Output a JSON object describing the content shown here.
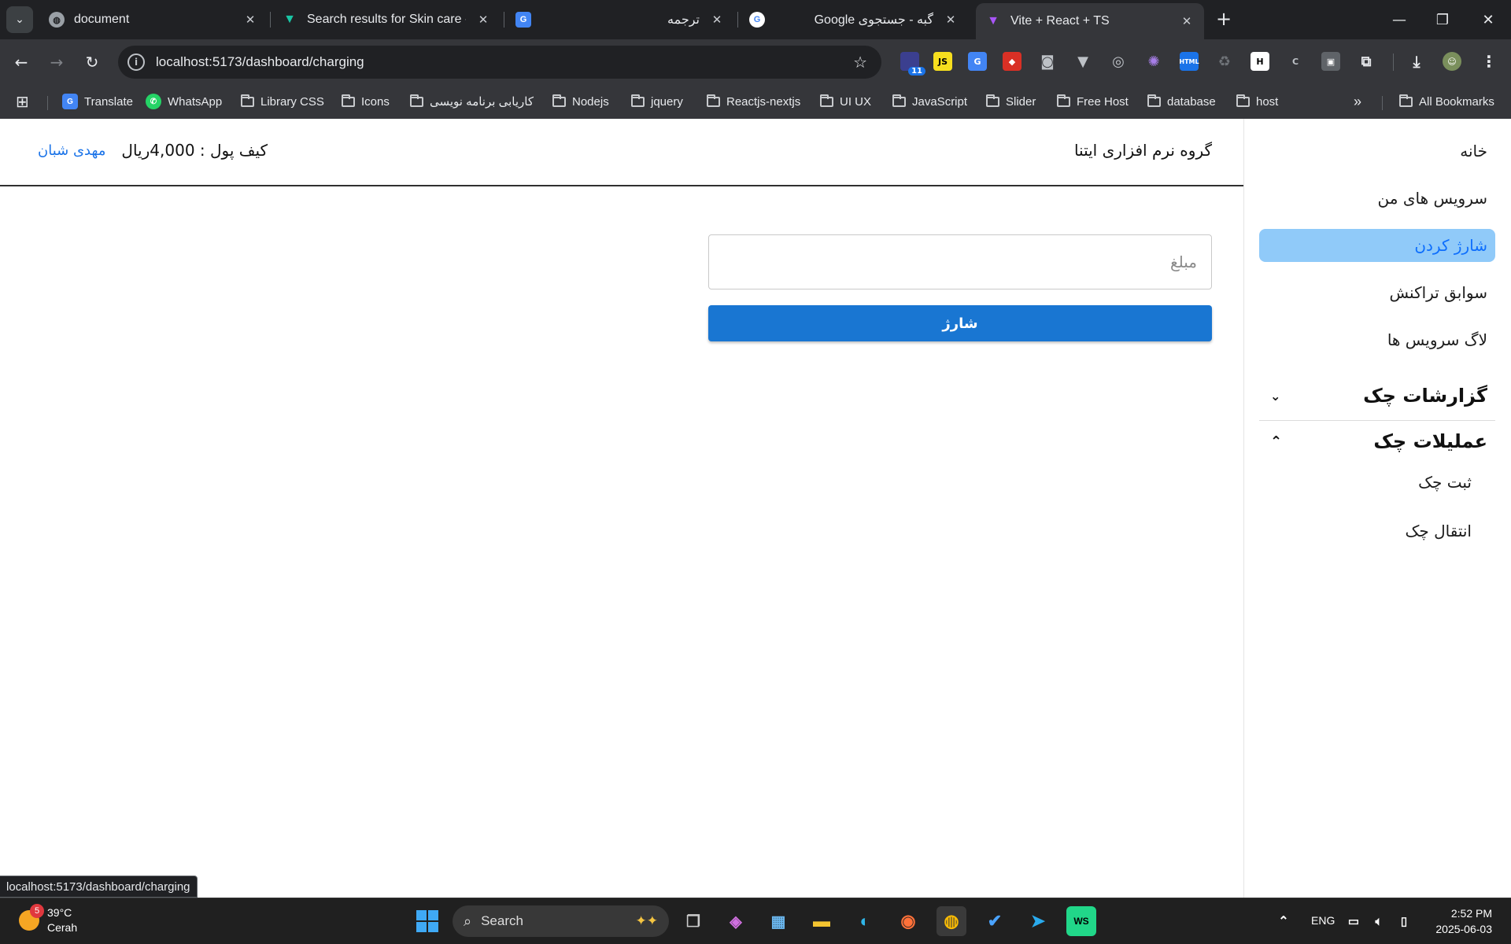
{
  "browser": {
    "tabs": [
      {
        "title": "document",
        "active": false
      },
      {
        "title": "Search results for Skin care - Fla",
        "active": false
      },
      {
        "title": "ترجمه",
        "active": false
      },
      {
        "title": "گبه - جستجوی Google",
        "active": false
      },
      {
        "title": "Vite + React + TS",
        "active": true
      }
    ],
    "url": "localhost:5173/dashboard/charging",
    "extension_badge": "11",
    "bookmarks": [
      {
        "label": "Translate",
        "type": "site"
      },
      {
        "label": "WhatsApp",
        "type": "site"
      },
      {
        "label": "Library CSS",
        "type": "folder"
      },
      {
        "label": "Icons",
        "type": "folder"
      },
      {
        "label": "کاریابی برنامه نویسی",
        "type": "folder"
      },
      {
        "label": "Nodejs",
        "type": "folder"
      },
      {
        "label": "jquery",
        "type": "folder"
      },
      {
        "label": "Reactjs-nextjs",
        "type": "folder"
      },
      {
        "label": "UI UX",
        "type": "folder"
      },
      {
        "label": "JavaScript",
        "type": "folder"
      },
      {
        "label": "Slider",
        "type": "folder"
      },
      {
        "label": "Free Host",
        "type": "folder"
      },
      {
        "label": "database",
        "type": "folder"
      },
      {
        "label": "host",
        "type": "folder"
      }
    ],
    "all_bookmarks": "All Bookmarks",
    "status_url": "localhost:5173/dashboard/charging"
  },
  "header": {
    "company": "گروه نرم افزاری ایتنا",
    "wallet": "کیف پول : 4,000ریال",
    "username": "مهدی شبان"
  },
  "sidebar": {
    "items": [
      {
        "label": "خانه",
        "active": false
      },
      {
        "label": "سرویس های من",
        "active": false
      },
      {
        "label": "شارژ کردن",
        "active": true
      },
      {
        "label": "سوابق تراکنش",
        "active": false
      },
      {
        "label": "لاگ سرویس ها",
        "active": false
      }
    ],
    "groups": [
      {
        "label": "گزارشات چک",
        "expanded": false,
        "children": []
      },
      {
        "label": "عملیلات چک",
        "expanded": true,
        "children": [
          "ثبت چک",
          "انتقال چک"
        ]
      }
    ],
    "active_bg": "#90caf9",
    "active_text": "#0d6efd"
  },
  "form": {
    "amount_placeholder": "مبلغ",
    "amount_value": "",
    "submit_label": "شارژ",
    "button_color": "#1976d2"
  },
  "taskbar": {
    "weather_temp": "39°C",
    "weather_desc": "Cerah",
    "weather_badge": "5",
    "search_label": "Search",
    "language": "ENG",
    "time": "2:52 PM",
    "date": "2025-06-03"
  }
}
